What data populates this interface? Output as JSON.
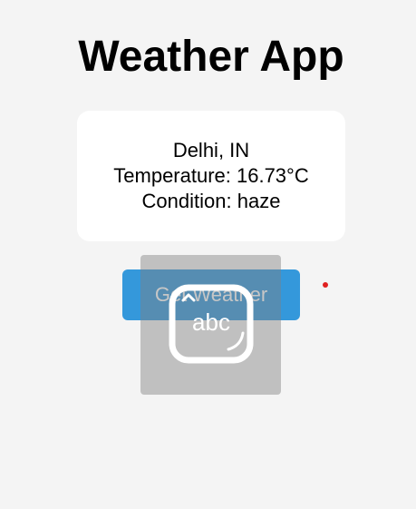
{
  "app": {
    "title": "Weather App"
  },
  "weather": {
    "location": "Delhi, IN",
    "temperature": "Temperature: 16.73°C",
    "condition": "Condition: haze"
  },
  "actions": {
    "get_weather_label": "Get Weather"
  },
  "overlay": {
    "keyboard_label": "abc",
    "icon": "keyboard-abc-icon"
  },
  "colors": {
    "background": "#f4f4f4",
    "button": "#3498db",
    "card": "#ffffff",
    "indicator": "#e02020"
  }
}
